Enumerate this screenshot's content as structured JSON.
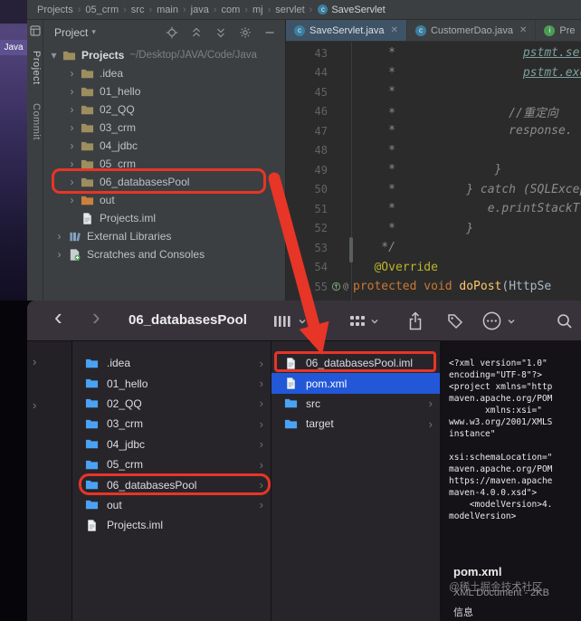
{
  "background": {
    "java_label": "Java"
  },
  "annotation_color": "#e73527",
  "ide": {
    "breadcrumb": {
      "items": [
        "Projects",
        "05_crm",
        "src",
        "main",
        "java",
        "com",
        "mj",
        "servlet"
      ],
      "current": "SaveServlet"
    },
    "tool_strip": {
      "project": "Project",
      "commit": "Commit"
    },
    "project_panel": {
      "title": "Project",
      "root": {
        "label": "Projects",
        "path": "~/Desktop/JAVA/Code/Java"
      },
      "items": [
        {
          "label": ".idea",
          "icon": "folder",
          "level": 1,
          "chevron": true
        },
        {
          "label": "01_hello",
          "icon": "folder",
          "level": 1,
          "chevron": true
        },
        {
          "label": "02_QQ",
          "icon": "folder",
          "level": 1,
          "chevron": true
        },
        {
          "label": "03_crm",
          "icon": "folder",
          "level": 1,
          "chevron": true
        },
        {
          "label": "04_jdbc",
          "icon": "folder",
          "level": 1,
          "chevron": true
        },
        {
          "label": "05_crm",
          "icon": "folder",
          "level": 1,
          "chevron": true
        },
        {
          "label": "06_databasesPool",
          "icon": "folder",
          "level": 1,
          "chevron": true,
          "annotated": true
        },
        {
          "label": "out",
          "icon": "folder-excluded",
          "level": 1,
          "chevron": true
        },
        {
          "label": "Projects.iml",
          "icon": "file",
          "level": 1,
          "chevron": false
        },
        {
          "label": "External Libraries",
          "icon": "library",
          "level": 0,
          "chevron": true
        },
        {
          "label": "Scratches and Consoles",
          "icon": "scratch",
          "level": 0,
          "chevron": true
        }
      ]
    },
    "tabs": [
      {
        "label": "SaveServlet.java",
        "icon": "class-icon",
        "icon_letter": "c",
        "icon_color": "#3a7fa0",
        "active": true,
        "closable": true
      },
      {
        "label": "CustomerDao.java",
        "icon": "class-icon",
        "icon_letter": "c",
        "icon_color": "#3a7fa0",
        "active": false,
        "closable": true
      },
      {
        "label": "Pre",
        "icon": "interface-icon",
        "icon_letter": "i",
        "icon_color": "#4a9c55",
        "active": false,
        "closable": false
      }
    ],
    "editor": {
      "lines": [
        {
          "n": "43",
          "seg": [
            [
              "com",
              "     *                  "
            ],
            [
              "comlink",
              "pstmt.set"
            ]
          ]
        },
        {
          "n": "44",
          "seg": [
            [
              "com",
              "     *                  "
            ],
            [
              "comlink",
              "pstmt.exe"
            ]
          ]
        },
        {
          "n": "45",
          "seg": [
            [
              "com",
              "     *"
            ]
          ]
        },
        {
          "n": "46",
          "seg": [
            [
              "com",
              "     *                //重定向"
            ]
          ]
        },
        {
          "n": "47",
          "seg": [
            [
              "com",
              "     *                response."
            ]
          ]
        },
        {
          "n": "48",
          "seg": [
            [
              "com",
              "     *"
            ]
          ]
        },
        {
          "n": "49",
          "seg": [
            [
              "com",
              "     *              }"
            ]
          ]
        },
        {
          "n": "50",
          "seg": [
            [
              "com",
              "     *          } catch (SQLExcep"
            ]
          ]
        },
        {
          "n": "51",
          "seg": [
            [
              "com",
              "     *             e.printStackT"
            ]
          ]
        },
        {
          "n": "52",
          "seg": [
            [
              "com",
              "     *          }"
            ]
          ]
        },
        {
          "n": "53",
          "seg": [
            [
              "com",
              "    */"
            ]
          ]
        },
        {
          "n": "54",
          "seg": [
            [
              "ann",
              "   @Override"
            ]
          ]
        },
        {
          "n": "55",
          "gutter_icons": true,
          "seg": [
            [
              "kw",
              "protected void "
            ],
            [
              "fn",
              "doPost"
            ],
            [
              "pln",
              "(HttpSe"
            ]
          ]
        }
      ]
    }
  },
  "finder": {
    "toolbar": {
      "title": "06_databasesPool"
    },
    "column_files": [
      {
        "label": ".idea",
        "icon": "folder",
        "chevron": true
      },
      {
        "label": "01_hello",
        "icon": "folder",
        "chevron": true
      },
      {
        "label": "02_QQ",
        "icon": "folder",
        "chevron": true
      },
      {
        "label": "03_crm",
        "icon": "folder",
        "chevron": true
      },
      {
        "label": "04_jdbc",
        "icon": "folder",
        "chevron": true
      },
      {
        "label": "05_crm",
        "icon": "folder",
        "chevron": true
      },
      {
        "label": "06_databasesPool",
        "icon": "folder",
        "chevron": true,
        "annotated": true
      },
      {
        "label": "out",
        "icon": "folder",
        "chevron": true
      },
      {
        "label": "Projects.iml",
        "icon": "file",
        "chevron": false
      }
    ],
    "column_detail": [
      {
        "label": "06_databasesPool.iml",
        "icon": "file",
        "chevron": false,
        "annotated": true
      },
      {
        "label": "pom.xml",
        "icon": "file",
        "chevron": false,
        "selected": true
      },
      {
        "label": "src",
        "icon": "folder",
        "chevron": true
      },
      {
        "label": "target",
        "icon": "folder",
        "chevron": true
      }
    ],
    "preview": {
      "xml_lines": [
        "<?xml version=\"1.0\"",
        "encoding=\"UTF-8\"?>",
        "<project xmlns=\"http",
        "maven.apache.org/POM",
        "       xmlns:xsi=\"",
        "www.w3.org/2001/XMLS",
        "instance\"",
        "",
        "xsi:schemaLocation=\"",
        "maven.apache.org/POM",
        "https://maven.apache",
        "maven-4.0.0.xsd\">",
        "    <modelVersion>4.",
        "modelVersion>"
      ],
      "file_name": "pom.xml",
      "file_meta": "XML Document - 2KB",
      "info_label": "信息",
      "watermark": "@稀土掘金技术社区"
    },
    "selection_color": "#2258d8",
    "folder_color": "#4aa2f5",
    "ide_folder_color": "#9c8e5e",
    "out_folder_color": "#c9813f"
  }
}
